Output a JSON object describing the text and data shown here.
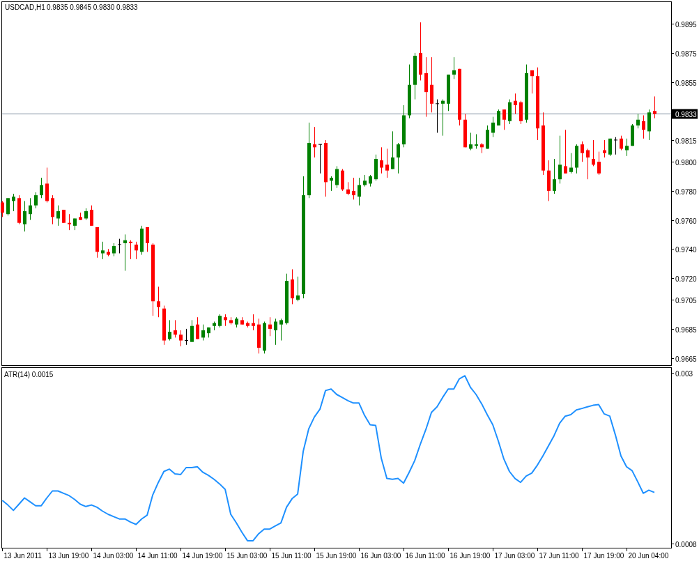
{
  "price_chart": {
    "title": "USDCAD,H1",
    "ohlc_readout": "0.9835 0.9845 0.9830 0.9833",
    "chart_data": {
      "type": "candlestick",
      "ylim": [
        0.966,
        0.9909
      ],
      "categories": [
        null,
        null,
        null,
        null,
        null,
        null,
        null,
        null,
        null,
        null,
        null,
        null,
        null,
        null,
        null,
        null,
        null,
        null,
        null,
        null,
        null,
        null,
        null,
        null,
        null,
        null,
        null,
        null,
        null,
        null,
        null,
        null,
        null,
        null,
        null,
        null,
        null,
        null,
        null,
        null,
        null,
        null,
        null,
        null,
        null,
        null,
        null,
        null,
        null,
        null,
        null,
        null,
        null,
        null,
        null,
        null,
        null,
        null,
        null,
        null,
        null,
        null,
        null,
        null,
        null,
        null,
        null,
        null,
        null,
        null,
        null,
        null,
        null,
        null,
        null,
        null,
        null,
        null,
        null,
        null,
        null,
        null,
        null,
        null,
        null,
        null,
        null,
        null,
        null,
        null,
        null,
        null,
        null,
        null,
        null,
        null,
        null,
        null,
        null,
        null,
        null,
        null,
        null,
        null,
        null,
        null,
        null,
        null,
        null,
        null,
        null,
        null,
        null,
        null,
        null,
        null,
        null,
        null
      ],
      "ohlc": [
        [
          0.9772,
          0.9773,
          0.9762,
          0.9765
        ],
        [
          0.9764,
          0.9775,
          0.9763,
          0.9775
        ],
        [
          0.9773,
          0.9778,
          0.9766,
          0.9776
        ],
        [
          0.9775,
          0.9777,
          0.9757,
          0.9758
        ],
        [
          0.9757,
          0.9773,
          0.9752,
          0.9766
        ],
        [
          0.9764,
          0.9775,
          0.976,
          0.977
        ],
        [
          0.977,
          0.9779,
          0.9768,
          0.9777
        ],
        [
          0.9777,
          0.9789,
          0.9775,
          0.9784
        ],
        [
          0.9785,
          0.9796,
          0.9772,
          0.9773
        ],
        [
          0.9775,
          0.9777,
          0.9757,
          0.9762
        ],
        [
          0.9761,
          0.977,
          0.9756,
          0.9766
        ],
        [
          0.9767,
          0.9767,
          0.9758,
          0.9758
        ],
        [
          0.9758,
          0.9764,
          0.9753,
          0.9757
        ],
        [
          0.9756,
          0.9761,
          0.9753,
          0.9761
        ],
        [
          0.9762,
          0.9765,
          0.976,
          0.976
        ],
        [
          0.9761,
          0.9768,
          0.976,
          0.9766
        ],
        [
          0.9767,
          0.977,
          0.9756,
          0.9756
        ],
        [
          0.9755,
          0.9755,
          0.9734,
          0.9738
        ],
        [
          0.9737,
          0.9745,
          0.9733,
          0.9739
        ],
        [
          0.9738,
          0.974,
          0.9735,
          0.9736
        ],
        [
          0.9737,
          0.9744,
          0.9735,
          0.9742
        ],
        [
          0.9743,
          0.9747,
          0.9737,
          0.9743
        ],
        [
          0.9744,
          0.975,
          0.9725,
          0.9746
        ],
        [
          0.9745,
          0.9746,
          0.9733,
          0.9744
        ],
        [
          0.9743,
          0.9745,
          0.9733,
          0.9739
        ],
        [
          0.9738,
          0.9756,
          0.9736,
          0.9754
        ],
        [
          0.9755,
          0.9755,
          0.9738,
          0.9744
        ],
        [
          0.9743,
          0.9744,
          0.9694,
          0.9704
        ],
        [
          0.9704,
          0.9714,
          0.9693,
          0.97
        ],
        [
          0.9699,
          0.9701,
          0.9674,
          0.9677
        ],
        [
          0.9678,
          0.9691,
          0.9677,
          0.9683
        ],
        [
          0.9684,
          0.9691,
          0.9679,
          0.9681
        ],
        [
          0.9681,
          0.9684,
          0.9673,
          0.9677
        ],
        [
          0.9677,
          0.9685,
          0.9674,
          0.9677
        ],
        [
          0.9676,
          0.9691,
          0.9676,
          0.9687
        ],
        [
          0.9688,
          0.9693,
          0.9678,
          0.9678
        ],
        [
          0.9679,
          0.9688,
          0.9677,
          0.9684
        ],
        [
          0.9682,
          0.9686,
          0.9679,
          0.9686
        ],
        [
          0.9687,
          0.969,
          0.9684,
          0.9689
        ],
        [
          0.9687,
          0.9695,
          0.9686,
          0.9694
        ],
        [
          0.9693,
          0.9695,
          0.9687,
          0.9691
        ],
        [
          0.9691,
          0.9693,
          0.9688,
          0.9689
        ],
        [
          0.9688,
          0.9693,
          0.9686,
          0.9692
        ],
        [
          0.9691,
          0.9693,
          0.9688,
          0.9688
        ],
        [
          0.9689,
          0.969,
          0.9686,
          0.9687
        ],
        [
          0.9689,
          0.9695,
          0.9684,
          0.9687
        ],
        [
          0.9688,
          0.9692,
          0.9668,
          0.9672
        ],
        [
          0.967,
          0.969,
          0.9668,
          0.9689
        ],
        [
          0.9688,
          0.9693,
          0.968,
          0.9685
        ],
        [
          0.9684,
          0.9692,
          0.9674,
          0.969
        ],
        [
          0.9688,
          0.9692,
          0.9677,
          0.9691
        ],
        [
          0.9689,
          0.9723,
          0.9688,
          0.9718
        ],
        [
          0.9719,
          0.9726,
          0.9702,
          0.9706
        ],
        [
          0.9705,
          0.9721,
          0.9704,
          0.9708
        ],
        [
          0.9709,
          0.979,
          0.9706,
          0.9777
        ],
        [
          0.9777,
          0.9827,
          0.9775,
          0.9813
        ],
        [
          0.9812,
          0.9824,
          0.9803,
          0.981
        ],
        [
          0.9812,
          0.9812,
          0.9792,
          0.9812
        ],
        [
          0.9813,
          0.9815,
          0.9776,
          0.9786
        ],
        [
          0.9787,
          0.979,
          0.978,
          0.9789
        ],
        [
          0.9784,
          0.9797,
          0.9782,
          0.9795
        ],
        [
          0.9794,
          0.9795,
          0.978,
          0.9781
        ],
        [
          0.9781,
          0.9786,
          0.9777,
          0.9778
        ],
        [
          0.978,
          0.9789,
          0.9774,
          0.9777
        ],
        [
          0.9776,
          0.9789,
          0.977,
          0.9784
        ],
        [
          0.9784,
          0.9791,
          0.9783,
          0.9787
        ],
        [
          0.9785,
          0.9791,
          0.9783,
          0.979
        ],
        [
          0.9788,
          0.9805,
          0.9787,
          0.9802
        ],
        [
          0.9801,
          0.981,
          0.9792,
          0.9796
        ],
        [
          0.9798,
          0.9809,
          0.9789,
          0.9794
        ],
        [
          0.9795,
          0.9821,
          0.9795,
          0.9803
        ],
        [
          0.9803,
          0.9813,
          0.9792,
          0.9812
        ],
        [
          0.9812,
          0.9839,
          0.981,
          0.9832
        ],
        [
          0.9832,
          0.9867,
          0.983,
          0.9853
        ],
        [
          0.9853,
          0.9875,
          0.9843,
          0.9873
        ],
        [
          0.9875,
          0.9896,
          0.9856,
          0.986
        ],
        [
          0.9861,
          0.9872,
          0.9831,
          0.9848
        ],
        [
          0.9853,
          0.9872,
          0.9834,
          0.984
        ],
        [
          0.984,
          0.9843,
          0.982,
          0.984
        ],
        [
          0.984,
          0.9843,
          0.9818,
          0.9842
        ],
        [
          0.984,
          0.986,
          0.9835,
          0.986
        ],
        [
          0.986,
          0.9872,
          0.9857,
          0.9863
        ],
        [
          0.9864,
          0.9864,
          0.9825,
          0.9829
        ],
        [
          0.9829,
          0.9833,
          0.981,
          0.981
        ],
        [
          0.9809,
          0.982,
          0.9808,
          0.9812
        ],
        [
          0.9811,
          0.9819,
          0.9809,
          0.9812
        ],
        [
          0.9812,
          0.9813,
          0.9806,
          0.981
        ],
        [
          0.9809,
          0.9825,
          0.9809,
          0.9822
        ],
        [
          0.982,
          0.9831,
          0.9817,
          0.9827
        ],
        [
          0.9825,
          0.9836,
          0.9825,
          0.9835
        ],
        [
          0.9836,
          0.9836,
          0.9822,
          0.9829
        ],
        [
          0.9828,
          0.9843,
          0.9826,
          0.9841
        ],
        [
          0.9842,
          0.9847,
          0.9833,
          0.9839
        ],
        [
          0.9841,
          0.9842,
          0.9826,
          0.9828
        ],
        [
          0.9829,
          0.9867,
          0.9827,
          0.9861
        ],
        [
          0.9863,
          0.9863,
          0.9847,
          0.9859
        ],
        [
          0.9859,
          0.9865,
          0.9815,
          0.9823
        ],
        [
          0.9825,
          0.9834,
          0.9791,
          0.9794
        ],
        [
          0.9794,
          0.9801,
          0.9773,
          0.978
        ],
        [
          0.978,
          0.9802,
          0.9778,
          0.9788
        ],
        [
          0.9788,
          0.9818,
          0.9785,
          0.9798
        ],
        [
          0.9797,
          0.9822,
          0.9792,
          0.9792
        ],
        [
          0.9793,
          0.9806,
          0.9792,
          0.9796
        ],
        [
          0.9796,
          0.9812,
          0.9792,
          0.9811
        ],
        [
          0.9812,
          0.9814,
          0.98,
          0.9806
        ],
        [
          0.9808,
          0.9809,
          0.9788,
          0.9803
        ],
        [
          0.9802,
          0.9815,
          0.9797,
          0.9798
        ],
        [
          0.98,
          0.9807,
          0.9791,
          0.9792
        ],
        [
          0.9808,
          0.9815,
          0.9803,
          0.9806
        ],
        [
          0.9805,
          0.9816,
          0.9804,
          0.9816
        ],
        [
          0.9815,
          0.9817,
          0.9805,
          0.9815
        ],
        [
          0.9816,
          0.9818,
          0.9808,
          0.9809
        ],
        [
          0.9808,
          0.9816,
          0.9804,
          0.9811
        ],
        [
          0.9811,
          0.9826,
          0.9811,
          0.9825
        ],
        [
          0.9825,
          0.9833,
          0.9823,
          0.9829
        ],
        [
          0.9828,
          0.9832,
          0.9816,
          0.9822
        ],
        [
          0.9821,
          0.9836,
          0.9815,
          0.9834
        ],
        [
          0.9835,
          0.9845,
          0.983,
          0.9833
        ]
      ],
      "yticks": [
        {
          "value": 0.9895,
          "label": "0.9895"
        },
        {
          "value": 0.9875,
          "label": "0.9875"
        },
        {
          "value": 0.9855,
          "label": "0.9855"
        },
        {
          "value": 0.9815,
          "label": "0.9815"
        },
        {
          "value": 0.98,
          "label": "0.9800"
        },
        {
          "value": 0.978,
          "label": "0.9780"
        },
        {
          "value": 0.976,
          "label": "0.9760"
        },
        {
          "value": 0.974,
          "label": "0.9740"
        },
        {
          "value": 0.972,
          "label": "0.9720"
        },
        {
          "value": 0.9705,
          "label": "0.9705"
        },
        {
          "value": 0.9685,
          "label": "0.9685"
        },
        {
          "value": 0.9665,
          "label": "0.9665"
        }
      ],
      "ref_lines": [
        {
          "axis": "y",
          "value": 0.9833,
          "label": "0.9833"
        }
      ]
    }
  },
  "indicator": {
    "title": "ATR(14) 0.0015",
    "chart_data": {
      "type": "line",
      "ylim": [
        0.00075,
        0.00306
      ],
      "categories": [
        null,
        null,
        null,
        null,
        null,
        null,
        null,
        null,
        null,
        null,
        null,
        null,
        null,
        null,
        null,
        null,
        null,
        null,
        null,
        null,
        null,
        null,
        null,
        null,
        null,
        null,
        null,
        null,
        null,
        null,
        null,
        null,
        null,
        null,
        null,
        null,
        null,
        null,
        null,
        null,
        null,
        null,
        null,
        null,
        null,
        null,
        null,
        null,
        null,
        null,
        null,
        null,
        null,
        null,
        null,
        null,
        null,
        null,
        null,
        null,
        null,
        null,
        null,
        null,
        null,
        null,
        null,
        null,
        null,
        null,
        null,
        null,
        null,
        null,
        null,
        null,
        null,
        null,
        null,
        null,
        null,
        null,
        null,
        null,
        null,
        null,
        null,
        null,
        null,
        null,
        null,
        null,
        null,
        null,
        null,
        null,
        null,
        null,
        null,
        null,
        null,
        null,
        null,
        null,
        null,
        null,
        null,
        null,
        null,
        null,
        null,
        null,
        null,
        null,
        null,
        null,
        null,
        null
      ],
      "series": [
        {
          "color": "#1e90ff",
          "values": [
            0.00136,
            0.0013,
            0.00123,
            0.00131,
            0.00139,
            0.00134,
            0.00129,
            0.00129,
            0.00139,
            0.00148,
            0.00148,
            0.00145,
            0.00142,
            0.00137,
            0.00131,
            0.00128,
            0.0013,
            0.00127,
            0.00122,
            0.00118,
            0.00115,
            0.00112,
            0.00112,
            0.00108,
            0.00105,
            0.00112,
            0.00117,
            0.00143,
            0.00159,
            0.00173,
            0.00176,
            0.0017,
            0.00169,
            0.00178,
            0.00178,
            0.00179,
            0.00172,
            0.00168,
            0.00163,
            0.00157,
            0.0015,
            0.00118,
            0.00107,
            0.00095,
            0.00084,
            0.00084,
            0.00093,
            0.00099,
            0.00099,
            0.00103,
            0.00107,
            0.00127,
            0.00138,
            0.00144,
            0.00199,
            0.00228,
            0.00243,
            0.00253,
            0.00277,
            0.00279,
            0.00272,
            0.00268,
            0.00264,
            0.00261,
            0.00261,
            0.00245,
            0.00233,
            0.00232,
            0.0019,
            0.00164,
            0.00163,
            0.00164,
            0.00158,
            0.00172,
            0.00187,
            0.00208,
            0.00227,
            0.00249,
            0.00256,
            0.00268,
            0.00279,
            0.00279,
            0.00292,
            0.00296,
            0.00281,
            0.00272,
            0.0026,
            0.00246,
            0.00233,
            0.00212,
            0.00189,
            0.00173,
            0.00164,
            0.00159,
            0.00167,
            0.00171,
            0.00181,
            0.00193,
            0.00206,
            0.00219,
            0.00235,
            0.00244,
            0.00246,
            0.00252,
            0.00254,
            0.00256,
            0.00258,
            0.00259,
            0.00247,
            0.00244,
            0.0022,
            0.00193,
            0.00179,
            0.00174,
            0.0016,
            0.00145,
            0.00149,
            0.00146
          ]
        }
      ],
      "yticks": [
        {
          "value": 0.003,
          "label": "0.003"
        },
        {
          "value": 0.0008,
          "label": "0.0008"
        }
      ]
    }
  },
  "time_axis": {
    "labels": [
      "13 Jun 2011",
      "13 Jun 19:00",
      "14 Jun 03:00",
      "14 Jun 11:00",
      "14 Jun 19:00",
      "15 Jun 03:00",
      "15 Jun 11:00",
      "15 Jun 19:00",
      "16 Jun 03:00",
      "16 Jun 11:00",
      "16 Jun 19:00",
      "17 Jun 03:00",
      "17 Jun 11:00",
      "17 Jun 19:00",
      "20 Jun 04:00"
    ]
  }
}
